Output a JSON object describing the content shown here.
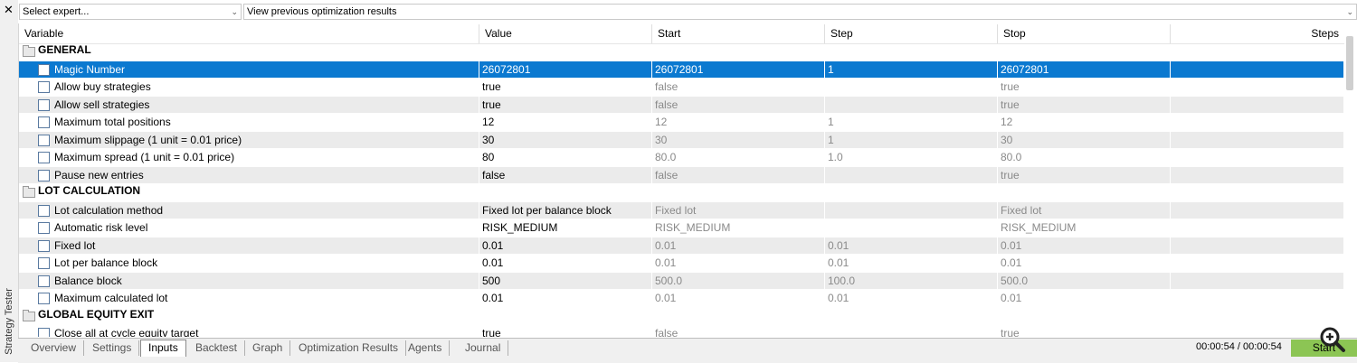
{
  "sidebar": {
    "close_icon": "✕",
    "label": "Strategy Tester"
  },
  "toolbar": {
    "expert_select": "Select expert...",
    "optimization_select": "View previous optimization results"
  },
  "grid": {
    "columns": [
      "Variable",
      "Value",
      "Start",
      "Step",
      "Stop",
      "Steps"
    ],
    "rows": [
      {
        "group": "GENERAL"
      },
      {
        "var": "Magic Number",
        "value": "26072801",
        "start": "26072801",
        "step": "1",
        "stop": "26072801",
        "steps": "",
        "selected": true
      },
      {
        "var": "Allow buy strategies",
        "value": "true",
        "start": "false",
        "step": "",
        "stop": "true",
        "steps": ""
      },
      {
        "var": "Allow sell strategies",
        "value": "true",
        "start": "false",
        "step": "",
        "stop": "true",
        "steps": ""
      },
      {
        "var": "Maximum total positions",
        "value": "12",
        "start": "12",
        "step": "1",
        "stop": "12",
        "steps": ""
      },
      {
        "var": "Maximum slippage (1 unit = 0.01 price)",
        "value": "30",
        "start": "30",
        "step": "1",
        "stop": "30",
        "steps": ""
      },
      {
        "var": "Maximum spread (1 unit = 0.01 price)",
        "value": "80",
        "start": "80.0",
        "step": "1.0",
        "stop": "80.0",
        "steps": ""
      },
      {
        "var": "Pause new entries",
        "value": "false",
        "start": "false",
        "step": "",
        "stop": "true",
        "steps": ""
      },
      {
        "group": "LOT CALCULATION"
      },
      {
        "var": "Lot calculation method",
        "value": "Fixed lot per balance block",
        "start": "Fixed lot",
        "step": "",
        "stop": "Fixed lot",
        "steps": ""
      },
      {
        "var": "Automatic risk level",
        "value": "RISK_MEDIUM",
        "start": "RISK_MEDIUM",
        "step": "",
        "stop": "RISK_MEDIUM",
        "steps": ""
      },
      {
        "var": "Fixed lot",
        "value": "0.01",
        "start": "0.01",
        "step": "0.01",
        "stop": "0.01",
        "steps": ""
      },
      {
        "var": "Lot per balance block",
        "value": "0.01",
        "start": "0.01",
        "step": "0.01",
        "stop": "0.01",
        "steps": ""
      },
      {
        "var": "Balance block",
        "value": "500",
        "start": "500.0",
        "step": "100.0",
        "stop": "500.0",
        "steps": ""
      },
      {
        "var": "Maximum calculated lot",
        "value": "0.01",
        "start": "0.01",
        "step": "0.01",
        "stop": "0.01",
        "steps": ""
      },
      {
        "group": "GLOBAL EQUITY EXIT"
      },
      {
        "var": "Close all at cycle equity target",
        "value": "true",
        "start": "false",
        "step": "",
        "stop": "true",
        "steps": ""
      }
    ]
  },
  "tabs": [
    {
      "label": "Overview",
      "active": false
    },
    {
      "label": "Settings",
      "active": false
    },
    {
      "label": "Inputs",
      "active": true
    },
    {
      "label": "Backtest",
      "active": false
    },
    {
      "label": "Graph",
      "active": false
    },
    {
      "label": "Optimization Results",
      "active": false
    },
    {
      "label": "Agents",
      "active": false
    },
    {
      "label": "Journal",
      "active": false
    }
  ],
  "status": {
    "timer": "00:00:54 / 00:00:54",
    "start_label": "Start"
  },
  "colors": {
    "selection": "#0b79d0",
    "start_button": "#8cc554",
    "alt_row": "#ebebeb"
  },
  "icons": {
    "close": "close-icon",
    "folder": "folder-icon",
    "zoom": "zoom-in-icon",
    "chevron": "chevron-down-icon"
  }
}
